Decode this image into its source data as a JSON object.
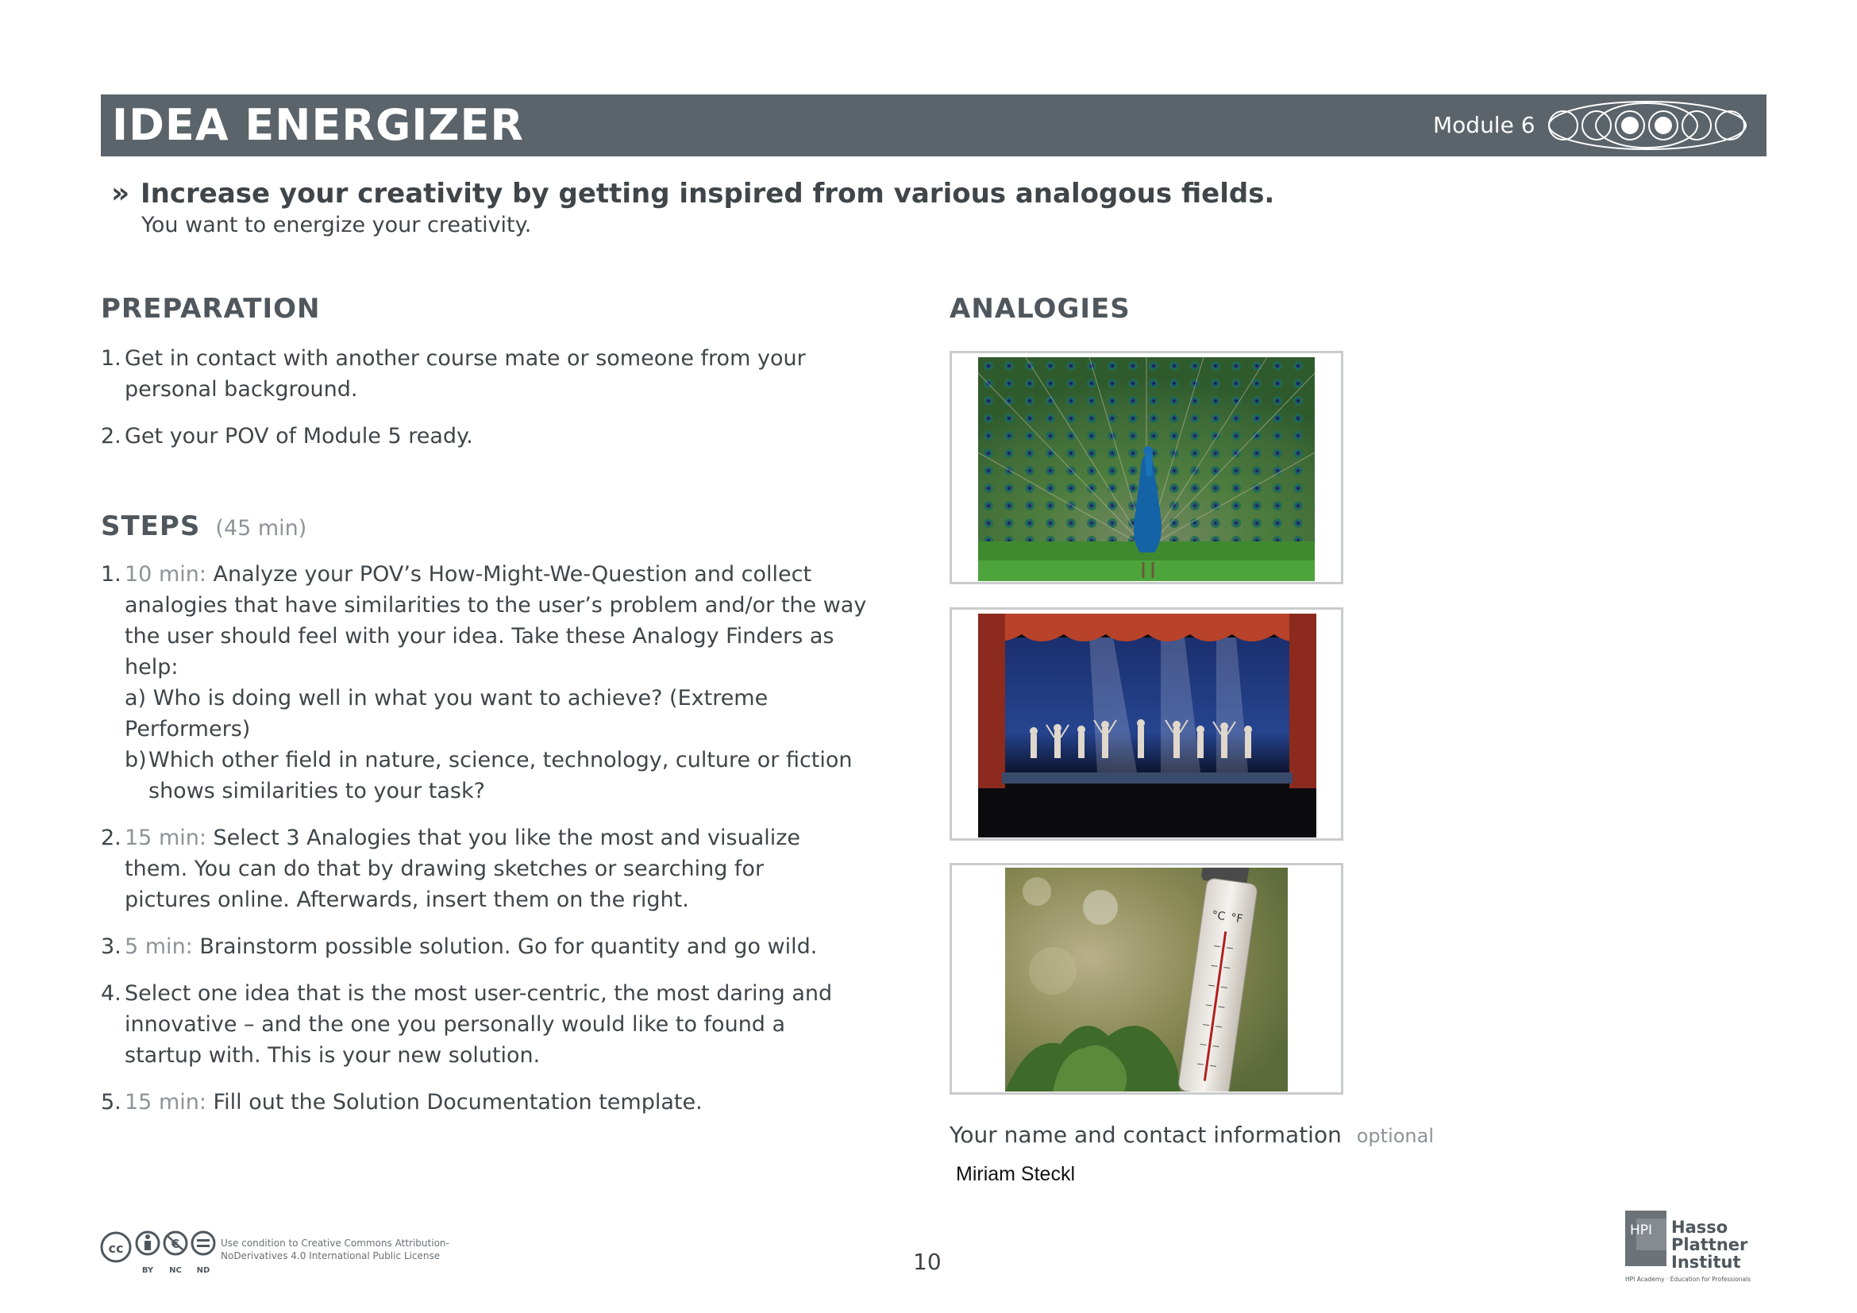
{
  "header": {
    "title": "IDEA ENERGIZER",
    "module": "Module 6",
    "module_circles_total": 6,
    "module_circles_active": [
      3,
      4
    ]
  },
  "subtitle": {
    "arrow": "»",
    "main": "Increase your creativity by getting inspired from various analogous fields.",
    "sub": "You want to energize your creativity."
  },
  "preparation": {
    "title": "PREPARATION",
    "items": [
      {
        "num": "1.",
        "text": "Get in contact with another course mate or someone from your personal background."
      },
      {
        "num": "2.",
        "text": "Get your POV of Module 5 ready."
      }
    ]
  },
  "steps": {
    "title": "STEPS",
    "duration": "(45 min)",
    "items": [
      {
        "num": "1.",
        "time": "10 min:",
        "text": "Analyze your POV’s How-Might-We-Question and collect analogies that have similarities to the user’s problem and/or the way the user should feel with your idea. Take these Analogy Finders as help:"
      },
      {
        "num": "2.",
        "time": "15 min:",
        "text": "Select 3 Analogies that you like the most and visualize them. You can do that by drawing sketches or searching for pictures online. Afterwards, insert them on the right."
      },
      {
        "num": "3.",
        "time": "5 min:",
        "text": "Brainstorm possible solution. Go for quantity and go wild."
      },
      {
        "num": "4.",
        "time": "",
        "text": "Select one idea that is the most user-centric, the most daring and innovative – and the one you personally would like to found a startup with. This is your new solution."
      },
      {
        "num": "5.",
        "time": "15 min:",
        "text": "Fill out the Solution Documentation template."
      }
    ],
    "subitems": [
      {
        "num": "a)",
        "text": "Who is doing well in what you want to achieve? (Extreme Performers)"
      },
      {
        "num": "b)",
        "text": "Which other field in nature, science, technology, culture or fiction shows similarities to your task?"
      }
    ]
  },
  "analogies": {
    "title": "ANALOGIES",
    "images": [
      "peacock-photo",
      "stage-performance-photo",
      "thermometer-photo"
    ],
    "thermometer_units": [
      "°C",
      "°F"
    ]
  },
  "contact": {
    "label": "Your name and contact information",
    "optional": "optional",
    "value": "Miriam Steckl"
  },
  "footer": {
    "cc_labels": [
      "BY",
      "NC",
      "ND"
    ],
    "cc_text": "Use condition to Creative Commons Attribution-NoDerivatives 4.0 International Public License",
    "page_number": "10",
    "logo_lines": [
      "Hasso",
      "Plattner",
      "Institut"
    ],
    "logo_box": "HPI",
    "logo_tagline": "HPI Academy · Education for Professionals"
  },
  "colors": {
    "header_bg": "#5b646b",
    "text": "#3f4549",
    "muted": "#8d9398",
    "frame_border": "#c9cbcd"
  }
}
